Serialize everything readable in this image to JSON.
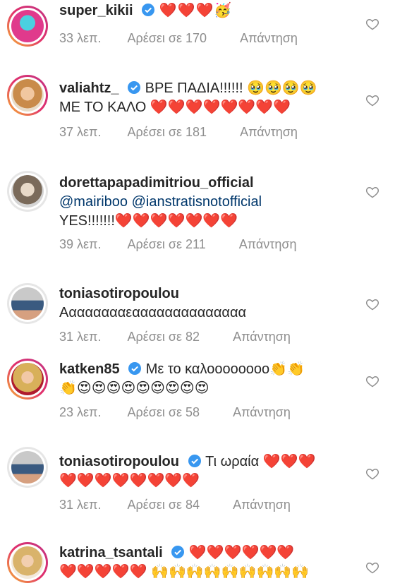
{
  "comments": [
    {
      "username": "super_kikii",
      "verified": true,
      "text": "",
      "emojis": "❤️❤️❤️🥳",
      "time": "33 λεπ.",
      "likes": "Αρέσει σε 170",
      "reply": "Απάντηση"
    },
    {
      "username": "valiahtz_",
      "verified": true,
      "text": "ΒΡΕ ΠΑΔΙΑ!!!!!! 🥹🥹🥹🥹",
      "line2": "ΜΕ ΤΟ ΚΑΛΟ ❤️❤️❤️❤️❤️❤️❤️❤️",
      "time": "37 λεπ.",
      "likes": "Αρέσει σε 181",
      "reply": "Απάντηση"
    },
    {
      "username": "dorettapapadimitriou_official",
      "verified": false,
      "line1_mention1": "@mairiboo",
      "line1_mention2": "@ianstratisnotofficial",
      "line2": "YES!!!!!!!❤️❤️❤️❤️❤️❤️❤️",
      "time": "39 λεπ.",
      "likes": "Αρέσει σε 211",
      "reply": "Απάντηση"
    },
    {
      "username": "toniasotiropoulou",
      "verified": false,
      "line1": "Ααααααααεαααααααααααααα",
      "time": "31 λεπ.",
      "likes": "Αρέσει σε 82",
      "reply": "Απάντηση"
    },
    {
      "username": "katken85",
      "verified": true,
      "text": "Με το καλοοοοοοοο👏👏",
      "line2": "👏😍😍😍😍😍😍😍😍😍",
      "time": "23 λεπ.",
      "likes": "Αρέσει σε 58",
      "reply": "Απάντηση"
    },
    {
      "username": "toniasotiropoulou",
      "verified": true,
      "text": "Τι ωραία ❤️❤️❤️",
      "line2": "❤️❤️❤️❤️❤️❤️❤️❤️",
      "time": "31 λεπ.",
      "likes": "Αρέσει σε 84",
      "reply": "Απάντηση"
    },
    {
      "username": "katrina_tsantali",
      "verified": true,
      "text": "❤️❤️❤️❤️❤️❤️",
      "line2": "❤️❤️❤️❤️❤️ 🙌🙌🙌🙌🙌🙌🙌🙌🙌"
    }
  ],
  "colors": {
    "text": "#262626",
    "meta": "#8e8e8e",
    "verified": "#3897f0",
    "heart": "#ed1c24",
    "mention": "#00376b"
  },
  "icons": {
    "like": "heart-outline-icon",
    "verified": "verified-badge-icon"
  }
}
